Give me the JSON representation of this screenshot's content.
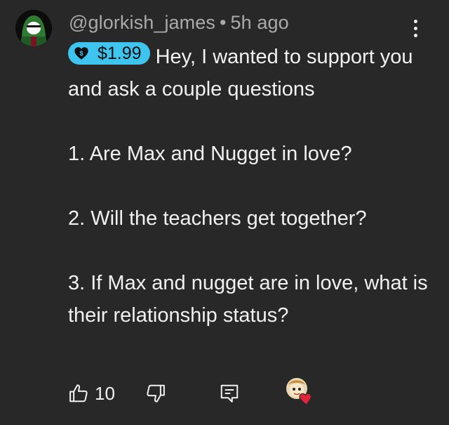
{
  "comment": {
    "author": "@glorkish_james",
    "separator": "•",
    "time_ago": "5h ago",
    "super_thanks": {
      "amount": "$1.99",
      "icon": "dollar-heart-icon",
      "badge_color": "#3ec5ef"
    },
    "first_line": "Hey, I wanted to support you and ask a couple questions",
    "paragraphs": [
      "1. Are Max and Nugget in love?",
      "2. Will the teachers get together?",
      "3. If Max and nugget are in love, what is their relationship status?"
    ],
    "actions": {
      "like_icon": "thumbs-up-icon",
      "like_count": "10",
      "dislike_icon": "thumbs-down-icon",
      "reply_icon": "reply-icon",
      "creator_heart_icon": "creator-heart-icon"
    },
    "menu_icon": "more-vertical-icon"
  },
  "colors": {
    "background": "#282828",
    "text": "#f1f1f1",
    "meta": "#aaaaaa",
    "heart": "#e0243a"
  }
}
